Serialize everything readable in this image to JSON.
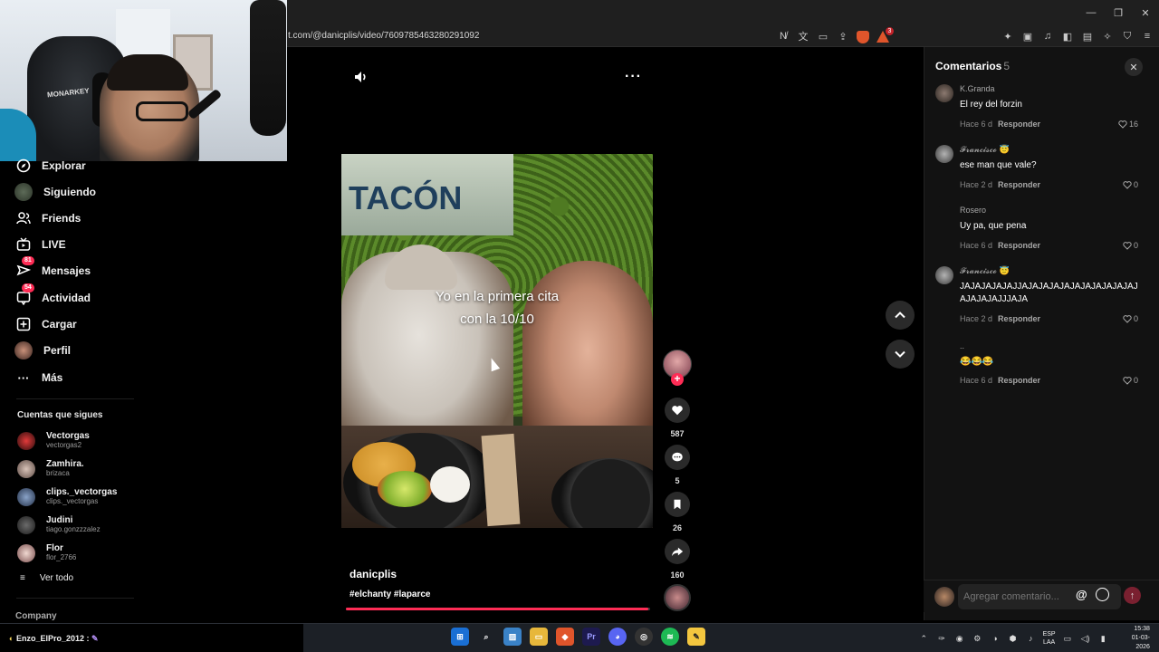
{
  "browser": {
    "url": "t.com/@danicplis/video/7609785463280291092",
    "brave_badge": "3"
  },
  "webcam": {
    "chair_brand": "MONARKEY"
  },
  "sidebar": {
    "items": [
      {
        "label": "Explorar",
        "icon": "compass-icon"
      },
      {
        "label": "Siguiendo",
        "icon": "avatar"
      },
      {
        "label": "Friends",
        "icon": "friends-icon"
      },
      {
        "label": "LIVE",
        "icon": "live-tv-icon"
      },
      {
        "label": "Mensajes",
        "icon": "messages-icon",
        "badge": "81"
      },
      {
        "label": "Actividad",
        "icon": "activity-icon",
        "badge": "54"
      },
      {
        "label": "Cargar",
        "icon": "upload-icon"
      },
      {
        "label": "Perfil",
        "icon": "avatar"
      },
      {
        "label": "Más",
        "icon": "more-icon"
      }
    ],
    "following_title": "Cuentas que sigues",
    "following": [
      {
        "name": "Vectorgas",
        "handle": "vectorgas2"
      },
      {
        "name": "Zamhira.",
        "handle": "brizaca"
      },
      {
        "name": "clips._vectorgas",
        "handle": "clips._vectorgas"
      },
      {
        "name": "Judini",
        "handle": "tiago.gonzzzalez"
      },
      {
        "name": "Flor",
        "handle": "flor_2766"
      }
    ],
    "see_all": "Ver todo",
    "company": "Company"
  },
  "video": {
    "sign_text": "TACÓN",
    "caption_line1": "Yo en la primera cita",
    "caption_line2": "con la 10/10",
    "author": "danicplis",
    "tags": "#elchanty #laparce",
    "progress": 0.995,
    "actions": {
      "likes": "587",
      "comments": "5",
      "saves": "26",
      "shares": "160"
    }
  },
  "comments": {
    "title": "Comentarios",
    "count": "5",
    "list": [
      {
        "user": "K.Granda",
        "text": "El rey del forzin",
        "time": "Hace 6 d",
        "likes": "16"
      },
      {
        "user": "𝓕𝓻𝓪𝓷𝓬𝓲𝓼𝓬𝓸 😇",
        "text": "ese man que vale?",
        "time": "Hace 2 d",
        "likes": "0"
      },
      {
        "user": "Rosero",
        "text": "Uy pa, que pena",
        "time": "Hace 6 d",
        "likes": "0"
      },
      {
        "user": "𝓕𝓻𝓪𝓷𝓬𝓲𝓼𝓬𝓸 😇",
        "text": "JAJAJAJAJAJJAJAJAJAJAJAJAJAJAJAJAJAJAJAJAJJJAJA",
        "time": "Hace 2 d",
        "likes": "0"
      },
      {
        "user": "..",
        "text": "😂😂😂",
        "time": "Hace 6 d",
        "likes": "0"
      }
    ],
    "reply_label": "Responder",
    "input_placeholder": "Agregar comentario..."
  },
  "taskbar": {
    "ticker_user": "Enzo_ElPro_2012 :",
    "lang_1": "ESP",
    "lang_2": "LAA",
    "time": "15:38",
    "date": "01-03-2026"
  }
}
